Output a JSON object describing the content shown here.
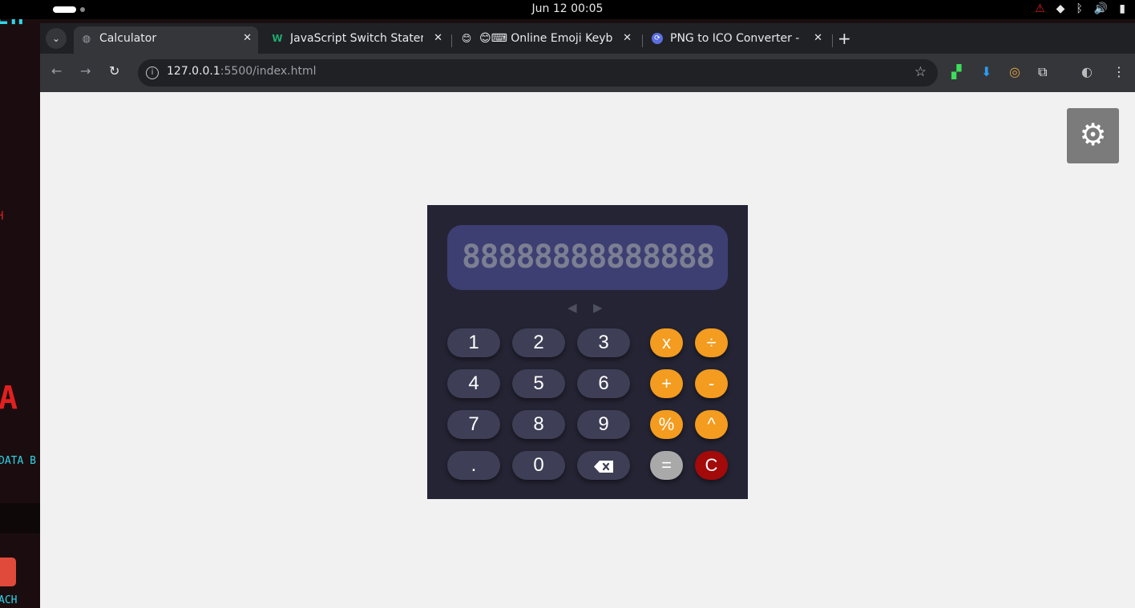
{
  "system": {
    "clock": "Jun 12  00:05",
    "tray_icons": [
      "warning-icon",
      "wifi-icon",
      "bluetooth-icon",
      "volume-icon",
      "battery-icon"
    ]
  },
  "desktop": {
    "text_top": "EH",
    "text_mid": "H",
    "text_big": "A",
    "text_data": "DATA B",
    "text_bottom": "ACH"
  },
  "browser": {
    "tabs": [
      {
        "label": "Calculator",
        "icon": "globe-icon",
        "active": true
      },
      {
        "label": "JavaScript Switch Statem",
        "icon": "w-icon",
        "active": false
      },
      {
        "label": "😊⌨ Online Emoji Keyb",
        "icon": "emoji-icon",
        "active": false
      },
      {
        "label": "PNG to ICO Converter - F",
        "icon": "convert-icon",
        "active": false
      }
    ],
    "close_glyph": "✕",
    "new_tab": "+",
    "address": {
      "host": "127.0.0.1",
      "rest": ":5500/index.html"
    }
  },
  "calculator": {
    "display": "88888888888888",
    "keys": {
      "k1": "1",
      "k2": "2",
      "k3": "3",
      "k4": "4",
      "k5": "5",
      "k6": "6",
      "k7": "7",
      "k8": "8",
      "k9": "9",
      "dot": ".",
      "k0": "0"
    },
    "ops": {
      "multiply": "x",
      "divide": "÷",
      "add": "+",
      "subtract": "-",
      "percent": "%",
      "power": "^",
      "equals": "=",
      "clear": "C"
    },
    "colors": {
      "operator": "#f39c1f",
      "equals": "#a9a9a9",
      "clear": "#a30a0a",
      "display": "#3d3f73",
      "body": "#252434"
    }
  }
}
